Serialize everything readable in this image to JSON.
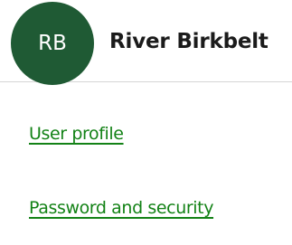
{
  "profile": {
    "avatar_initials": "RB",
    "avatar_color": "#1f5a34",
    "name": "River Birkbelt"
  },
  "nav": {
    "link_color": "#138216",
    "items": [
      {
        "label": "User profile"
      },
      {
        "label": "Password and security"
      }
    ]
  }
}
